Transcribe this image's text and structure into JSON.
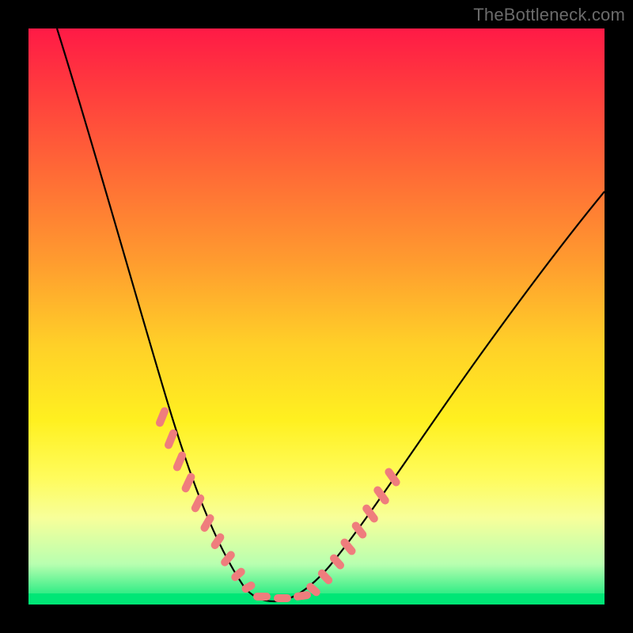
{
  "watermark": "TheBottleneck.com",
  "colors": {
    "dot": "#ef7d7d",
    "curve": "#000000",
    "green": "#00e676"
  },
  "chart_data": {
    "type": "line",
    "title": "",
    "xlabel": "",
    "ylabel": "",
    "xlim": [
      0,
      100
    ],
    "ylim": [
      0,
      100
    ],
    "grid": false,
    "legend": false,
    "annotations": [
      "TheBottleneck.com"
    ],
    "series": [
      {
        "name": "bottleneck-curve",
        "x": [
          5,
          10,
          15,
          20,
          23,
          26,
          29,
          31,
          33,
          35,
          37,
          40,
          43,
          47,
          52,
          58,
          65,
          73,
          82,
          92,
          100
        ],
        "y": [
          100,
          85,
          69,
          52,
          41,
          31,
          22,
          15,
          9,
          4,
          1,
          0,
          1,
          4,
          10,
          18,
          27,
          37,
          47,
          57,
          65
        ]
      }
    ],
    "highlight_segments": [
      {
        "side": "left",
        "x_range": [
          20,
          35
        ],
        "comment": "pink dotted segment on left branch descending toward trough"
      },
      {
        "side": "floor",
        "x_range": [
          35,
          45
        ],
        "comment": "pink dotted segment across the flat trough"
      },
      {
        "side": "right",
        "x_range": [
          45,
          58
        ],
        "comment": "pink dotted segment on right branch ascending from trough"
      }
    ],
    "markers_xy": [
      [
        21.5,
        46
      ],
      [
        22.8,
        41
      ],
      [
        24.0,
        36
      ],
      [
        25.3,
        31.5
      ],
      [
        26.5,
        27
      ],
      [
        27.6,
        23
      ],
      [
        28.7,
        19.5
      ],
      [
        29.7,
        16
      ],
      [
        30.6,
        13
      ],
      [
        31.5,
        10.5
      ],
      [
        32.4,
        8.2
      ],
      [
        33.2,
        6.3
      ],
      [
        34.0,
        4.7
      ],
      [
        34.8,
        3.3
      ],
      [
        35.5,
        2.2
      ],
      [
        36.5,
        1.3
      ],
      [
        37.5,
        0.8
      ],
      [
        38.5,
        0.5
      ],
      [
        39.5,
        0.4
      ],
      [
        40.5,
        0.5
      ],
      [
        41.5,
        0.8
      ],
      [
        42.5,
        1.3
      ],
      [
        43.5,
        2.0
      ],
      [
        44.5,
        3.0
      ],
      [
        45.5,
        4.3
      ],
      [
        46.5,
        5.8
      ],
      [
        47.5,
        7.5
      ],
      [
        48.7,
        9.5
      ],
      [
        50.0,
        12.0
      ],
      [
        51.3,
        14.8
      ],
      [
        52.7,
        17.8
      ],
      [
        54.2,
        21.0
      ],
      [
        55.7,
        24.5
      ]
    ]
  }
}
